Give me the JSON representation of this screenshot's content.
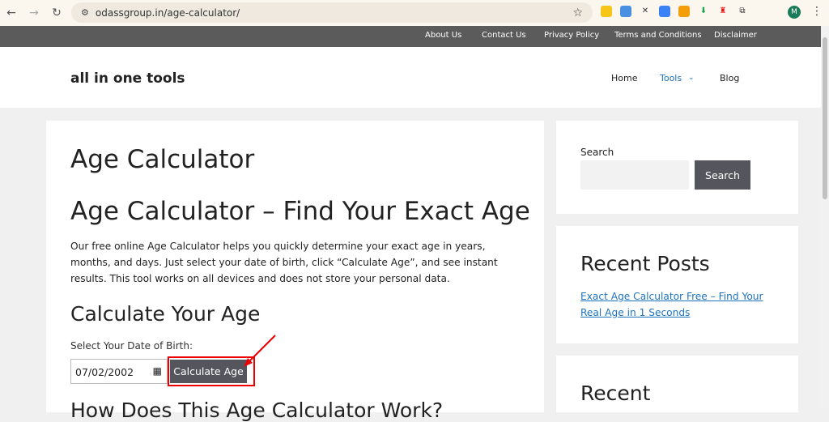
{
  "browser": {
    "url": "odassgroup.in/age-calculator/",
    "avatar": "M"
  },
  "topbar": {
    "links": [
      "About Us",
      "Contact Us",
      "Privacy Policy",
      "Terms and Conditions",
      "Disclaimer"
    ]
  },
  "header": {
    "logo": "all in one tools",
    "nav": [
      "Home",
      "Tools",
      "Blog"
    ]
  },
  "main": {
    "title": "Age Calculator",
    "heading": "Age Calculator – Find Your Exact Age",
    "intro": "Our free online Age Calculator helps you quickly determine your exact age in years, months, and days. Just select your date of birth, click “Calculate Age”, and see instant results. This tool works on all devices and does not store your personal data.",
    "calc_heading": "Calculate Your Age",
    "dob_label": "Select Your Date of Birth:",
    "dob_value": "07/02/2002",
    "calc_button": "Calculate Age",
    "next_heading": "How Does This Age Calculator Work?"
  },
  "sidebar": {
    "search_label": "Search",
    "search_button": "Search",
    "recent_posts_title": "Recent Posts",
    "recent_post": "Exact Age Calculator Free – Find Your Real Age in 1 Seconds",
    "recent_title2": "Recent"
  },
  "annotation_color": "#e00000"
}
